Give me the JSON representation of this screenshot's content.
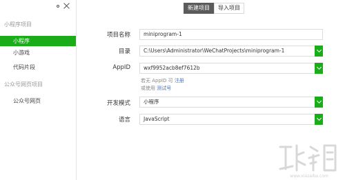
{
  "sidebar": {
    "sections": [
      {
        "title": "小程序项目",
        "items": [
          {
            "label": "小程序",
            "active": true
          },
          {
            "label": "小游戏",
            "active": false
          },
          {
            "label": "代码片段",
            "active": false
          }
        ]
      },
      {
        "title": "公众号网页项目",
        "items": [
          {
            "label": "公众号网页",
            "active": false
          }
        ]
      }
    ]
  },
  "tabs": {
    "new_project": "新建项目",
    "import_project": "导入项目",
    "active": "new_project"
  },
  "form": {
    "project_name": {
      "label": "项目名称",
      "value": "miniprogram-1"
    },
    "directory": {
      "label": "目录",
      "value": "C:\\Users\\Administrator\\WeChatProjects\\miniprogram-1"
    },
    "appid": {
      "label": "AppID",
      "value": "wxf9952acb8ef7612b"
    },
    "appid_hint": {
      "line1_prefix": "若无 AppID 可",
      "line1_link": "注册",
      "line2_prefix": "或使用",
      "line2_link": "测试号"
    },
    "dev_mode": {
      "label": "开发模式",
      "value": "小程序"
    },
    "language": {
      "label": "语言",
      "value": "JavaScript"
    }
  },
  "colors": {
    "accent": "#1aad19",
    "tab_active": "#5b5b5b",
    "link": "#4a77c4"
  }
}
